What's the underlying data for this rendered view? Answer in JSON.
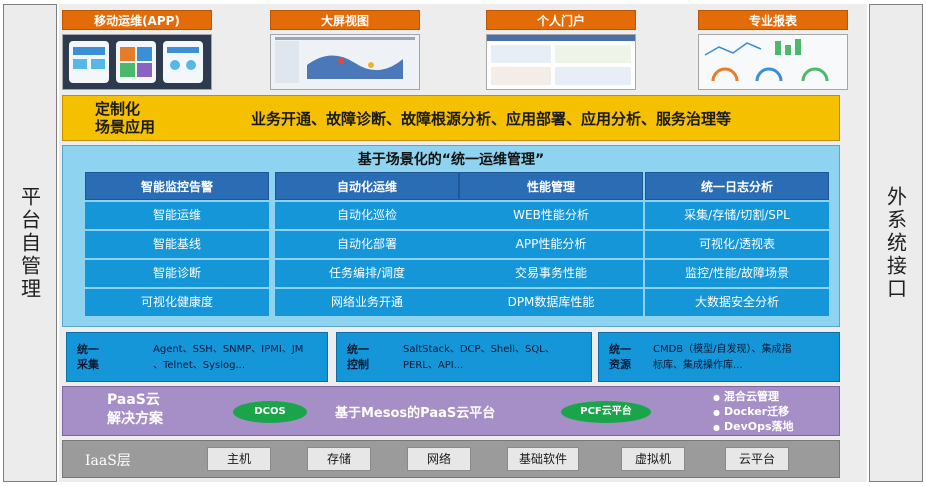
{
  "left_side_label": "平台自管理",
  "right_side_label": "外系统接口",
  "apps": [
    {
      "title": "移动运维(APP)",
      "icon": "mobile-app-screenshot"
    },
    {
      "title": "大屏视图",
      "icon": "big-screen-map-screenshot"
    },
    {
      "title": "个人门户",
      "icon": "personal-portal-screenshot"
    },
    {
      "title": "专业报表",
      "icon": "report-dashboard-screenshot"
    }
  ],
  "custom": {
    "title_line1": "定制化",
    "title_line2": "场景应用",
    "text": "业务开通、故障诊断、故障根源分析、应用部署、应用分析、服务治理等"
  },
  "ops": {
    "title": "基于场景化的“统一运维管理”",
    "columns": [
      {
        "head": "智能监控告警",
        "items": [
          "智能运维",
          "智能基线",
          "智能诊断",
          "可视化健康度"
        ]
      },
      {
        "head": "自动化运维",
        "items": [
          "自动化巡检",
          "自动化部署",
          "任务编排/调度",
          "网络业务开通"
        ]
      },
      {
        "head": "性能管理",
        "items": [
          "WEB性能分析",
          "APP性能分析",
          "交易事务性能",
          "DPM数据库性能"
        ]
      },
      {
        "head": "统一日志分析",
        "items": [
          "采集/存储/切割/SPL",
          "可视化/透视表",
          "监控/性能/故障场景",
          "大数据安全分析"
        ]
      }
    ]
  },
  "unify": [
    {
      "label1": "统一",
      "label2": "采集",
      "text": "Agent、SSH、SNMP、IPMI、JM\n、Telnet、Syslog..."
    },
    {
      "label1": "统一",
      "label2": "控制",
      "text": "SaltStack、DCP、Shell、SQL、\nPERL、API..."
    },
    {
      "label1": "统一",
      "label2": "资源",
      "text": "CMDB（模型/自发现）、集成指\n标库、集成操作库..."
    }
  ],
  "paas": {
    "title_line1": "PaaS云",
    "title_line2": "解决方案",
    "ellipse1": "DCOS",
    "main": "基于Mesos的PaaS云平台",
    "ellipse2": "PCF云平台",
    "list": [
      "混合云管理",
      "Docker迁移",
      "DevOps落地"
    ]
  },
  "iaas": {
    "title": "IaaS层",
    "items": [
      "主机",
      "存储",
      "网络",
      "基础软件",
      "虚拟机",
      "云平台"
    ]
  },
  "colors": {
    "app_orange": "#e36c09",
    "custom_yellow": "#f5c000",
    "ops_light_blue": "#8ed3f0",
    "column_head_blue": "#2a6db5",
    "item_blue": "#1596d8",
    "paas_purple": "#a58fc6",
    "ellipse_green": "#1aa54a",
    "iaas_gray": "#9b9b9b"
  }
}
